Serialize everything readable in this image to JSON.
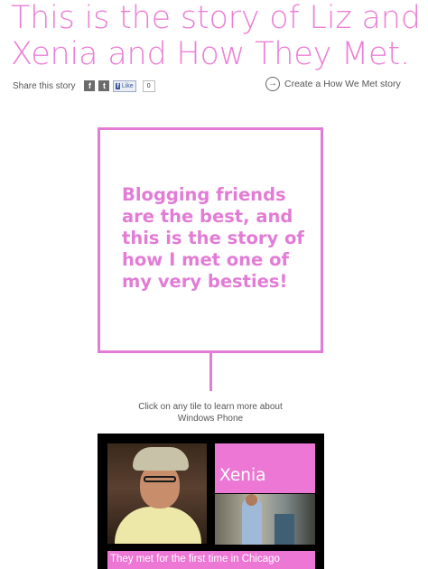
{
  "story": {
    "title": "This is the story of Liz and Xenia and How They Met."
  },
  "share": {
    "label": "Share this story",
    "facebook_icon": "f",
    "twitter_icon": "t",
    "like_label": "Like",
    "like_f": "f",
    "like_count": "0"
  },
  "create_link": {
    "label": "Create a How We Met story",
    "icon": "→"
  },
  "quote": {
    "text": "Blogging friends are the best, and this is the story of how I met one of my very besties!"
  },
  "hint": {
    "text": "Click on any tile to learn more about Windows Phone"
  },
  "tiles": {
    "name": "Xenia",
    "caption": "They met for the first time in Chicago"
  },
  "colors": {
    "accent": "#ec77d4",
    "title": "#ec7fd6"
  }
}
